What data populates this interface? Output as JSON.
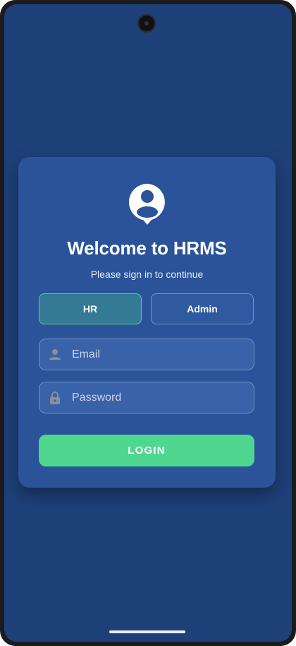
{
  "app": {
    "title": "Welcome to HRMS",
    "subtitle": "Please sign in to continue"
  },
  "role_toggle": {
    "options": [
      "HR",
      "Admin"
    ],
    "selected": "HR"
  },
  "form": {
    "email_placeholder": "Email",
    "password_placeholder": "Password",
    "email_icon": "person-icon",
    "password_icon": "lock-icon"
  },
  "actions": {
    "login_label": "LOGIN"
  },
  "colors": {
    "background": "#1e4079",
    "card": "#2a5399",
    "accent": "#4fd68f",
    "selected_role": "#357a95"
  }
}
